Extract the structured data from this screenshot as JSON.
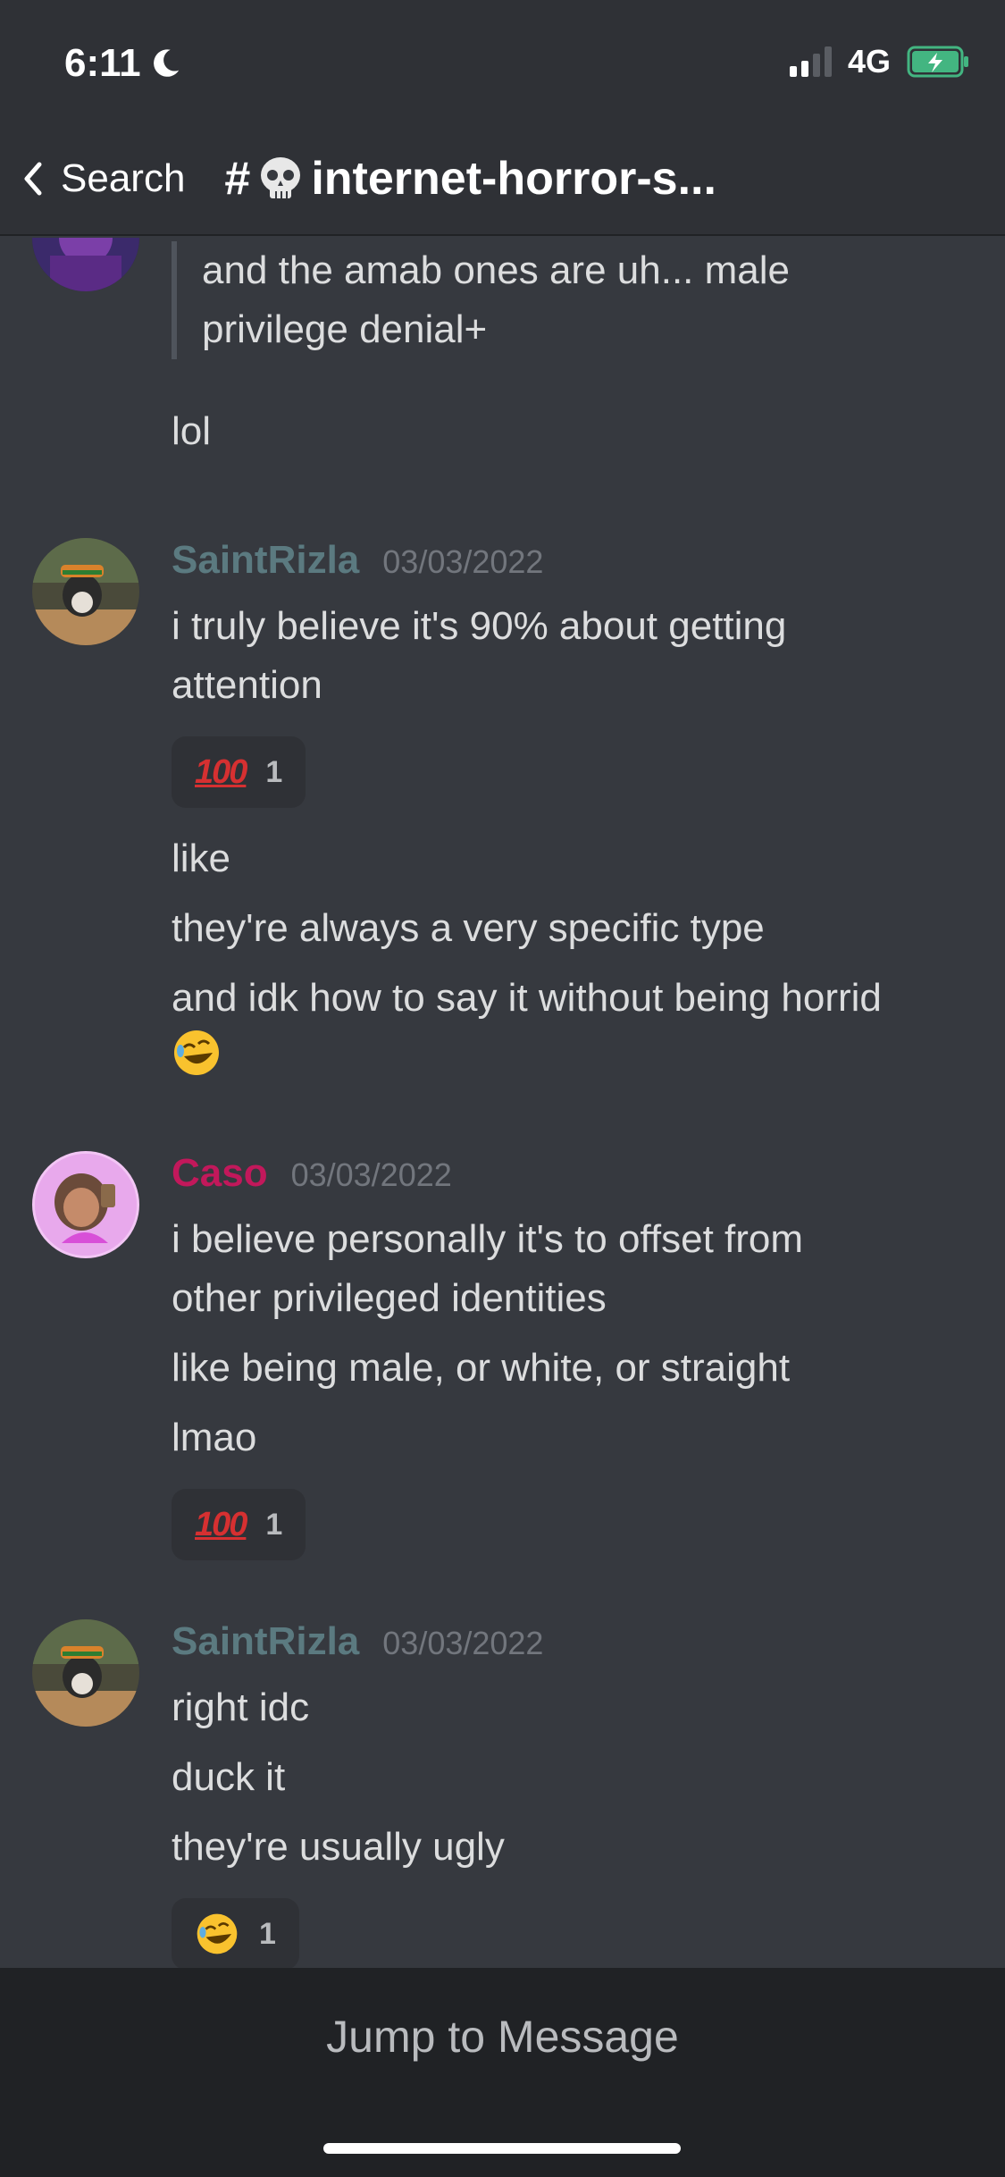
{
  "status": {
    "time": "6:11",
    "network": "4G"
  },
  "header": {
    "back_label": "Search",
    "channel_prefix": "#",
    "channel_name": "internet-horror-s..."
  },
  "messages": {
    "m0": {
      "quote_line1": "and the amab ones are uh... male",
      "quote_line2": "privilege denial+",
      "text": "lol"
    },
    "m1": {
      "username": "SaintRizla",
      "timestamp": "03/03/2022",
      "line1": "i truly believe it's 90% about getting",
      "line2": "attention",
      "reaction_count": "1",
      "line3": "like",
      "line4": "they're always a very specific type",
      "line5": "and idk how to say it without being horrid"
    },
    "m2": {
      "username": "Caso",
      "timestamp": "03/03/2022",
      "line1": "i believe personally it's to offset from",
      "line2": "other privileged identities",
      "line3": "like being male, or white, or straight",
      "line4": "lmao",
      "reaction_count": "1"
    },
    "m3": {
      "username": "SaintRizla",
      "timestamp": "03/03/2022",
      "line1": "right idc",
      "line2": "duck it",
      "line3": "they're usually ugly",
      "reaction_count": "1"
    }
  },
  "reaction_icons": {
    "hundred": "100",
    "laugh": "rolling-on-floor-laughing-icon"
  },
  "footer": {
    "jump_label": "Jump to Message"
  },
  "colors": {
    "saintrizla": "#5b7a80",
    "caso": "#c2185b",
    "background": "#36393f",
    "header": "#2f3136"
  }
}
